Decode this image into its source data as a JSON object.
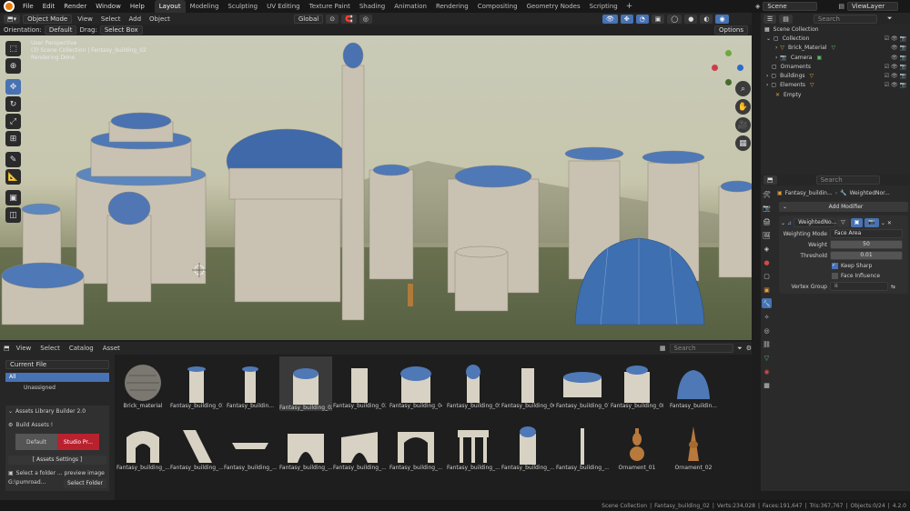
{
  "menu": [
    "File",
    "Edit",
    "Render",
    "Window",
    "Help"
  ],
  "workspaces": [
    "Layout",
    "Modeling",
    "Sculpting",
    "UV Editing",
    "Texture Paint",
    "Shading",
    "Animation",
    "Rendering",
    "Compositing",
    "Geometry Nodes",
    "Scripting"
  ],
  "scene": "Scene",
  "view_layer": "ViewLayer",
  "viewport_header": {
    "mode": "Object Mode",
    "items": [
      "View",
      "Select",
      "Add",
      "Object"
    ],
    "transform": "Global",
    "orientation_label": "Orientation:",
    "orientation": "Default",
    "drag_label": "Drag:",
    "drag": "Select Box",
    "options": "Options"
  },
  "overlay": {
    "line1": "User Perspective",
    "line2": "(3) Scene Collection | Fantasy_building_02",
    "line3": "Rendering Done"
  },
  "outliner": {
    "search_placeholder": "Search",
    "rows": [
      {
        "label": "Scene Collection"
      },
      {
        "label": "Collection"
      },
      {
        "label": "Brick_Material"
      },
      {
        "label": "Camera"
      },
      {
        "label": "Ornaments"
      },
      {
        "label": "Buildings"
      },
      {
        "label": "Elements"
      },
      {
        "label": "Empty"
      }
    ]
  },
  "properties": {
    "search_placeholder": "Search",
    "breadcrumb_object": "Fantasy_buildin...",
    "breadcrumb_modifier": "WeightedNor...",
    "add_modifier": "Add Modifier",
    "modifier_name": "WeightedNo...",
    "fields": {
      "weighting_mode_label": "Weighting Mode",
      "weighting_mode": "Face Area",
      "weight_label": "Weight",
      "weight": "50",
      "threshold_label": "Threshold",
      "threshold": "0.01",
      "keep_sharp": "Keep Sharp",
      "face_influence": "Face Influence",
      "vertex_group_label": "Vertex Group"
    }
  },
  "asset_browser": {
    "menus": [
      "View",
      "Select",
      "Catalog",
      "Asset"
    ],
    "search_placeholder": "Search",
    "library": "Current File",
    "catalogs": [
      "All",
      "Unassigned"
    ],
    "builder_title": "Assets Library Builder 2.0",
    "build_assets": "Build Assets !",
    "default_btn": "Default",
    "studio_btn": "Studio Pr...",
    "settings_btn": "[ Assets Settings ]",
    "select_folder_text": "Select a folder ... preview image",
    "path": "G:\\pumroad...",
    "select_folder_btn": "Select Folder",
    "row1": [
      "Brick_material",
      "Fantasy_building_01",
      "Fantasy_buildin...",
      "Fantasy_building_02",
      "Fantasy_building_03",
      "Fantasy_building_04",
      "Fantasy_building_05",
      "Fantasy_building_06",
      "Fantasy_building_07",
      "Fantasy_building_08",
      "Fantasy_buildin..."
    ],
    "row2": [
      "Fantasy_building_...",
      "Fantasy_building_...",
      "Fantasy_building_...",
      "Fantasy_building_...",
      "Fantasy_building_...",
      "Fantasy_building_...",
      "Fantasy_building_...",
      "Fantasy_building_...",
      "Fantasy_building_...",
      "Ornament_01",
      "Ornament_02"
    ]
  },
  "status": {
    "collection": "Scene Collection",
    "object": "Fantasy_building_02",
    "verts": "Verts:234,028",
    "faces": "Faces:191,647",
    "tris": "Tris:367,767",
    "objects": "Objects:0/24",
    "version": "4.2.0"
  },
  "colors": {
    "accent": "#4772b3",
    "header": "#181818",
    "panel": "#282828"
  }
}
